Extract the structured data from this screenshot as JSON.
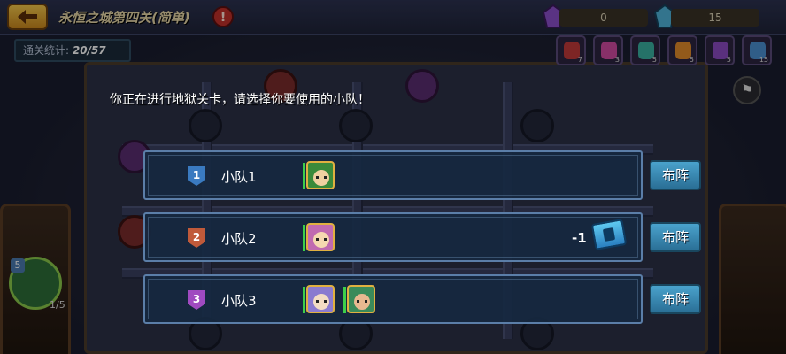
{
  "header": {
    "stage_title": "永恒之城第四关(简单)",
    "help_label": "!",
    "resources": [
      {
        "name": "purple-crystal",
        "value": "0",
        "color": "#8b4fc9"
      },
      {
        "name": "blue-crystal",
        "value": "15",
        "color": "#4fb2d9"
      }
    ]
  },
  "stats": {
    "label": "通关统计:",
    "value": "20/57"
  },
  "items": [
    {
      "icon": "red-potion-icon",
      "color": "#c03a3a",
      "count": "7"
    },
    {
      "icon": "pink-potion-icon",
      "color": "#d04aa0",
      "count": "3"
    },
    {
      "icon": "teal-ticket-icon",
      "color": "#3ab0a0",
      "count": "5"
    },
    {
      "icon": "orange-ticket-icon",
      "color": "#e08a2a",
      "count": "5"
    },
    {
      "icon": "purple-bottle-icon",
      "color": "#8a4ac0",
      "count": "5"
    },
    {
      "icon": "blue-bottle-icon",
      "color": "#4a90d0",
      "count": "15"
    }
  ],
  "dialog": {
    "prompt": "你正在进行地狱关卡，请选择你要使用的小队！",
    "squads": [
      {
        "badge": "1",
        "badge_color": "#3a7ac0",
        "name": "小队1",
        "heroes": [
          {
            "name": "green-hair-hero",
            "bg": "#3a8a3a",
            "face": "#f0d0a0"
          }
        ],
        "cost": "",
        "button": "布阵"
      },
      {
        "badge": "2",
        "badge_color": "#c05a3a",
        "name": "小队2",
        "heroes": [
          {
            "name": "orange-hair-hero",
            "bg": "#c06ab0",
            "face": "#f5d8b0"
          }
        ],
        "cost": "-1",
        "button": "布阵"
      },
      {
        "badge": "3",
        "badge_color": "#a04ac0",
        "name": "小队3",
        "heroes": [
          {
            "name": "silver-hair-hero",
            "bg": "#8a7ad0",
            "face": "#f3dcc4"
          },
          {
            "name": "dark-hair-hero",
            "bg": "#3a8a5a",
            "face": "#e8b890"
          }
        ],
        "cost": "",
        "button": "布阵"
      }
    ]
  },
  "side": {
    "badge": "5",
    "count": "1/5"
  }
}
